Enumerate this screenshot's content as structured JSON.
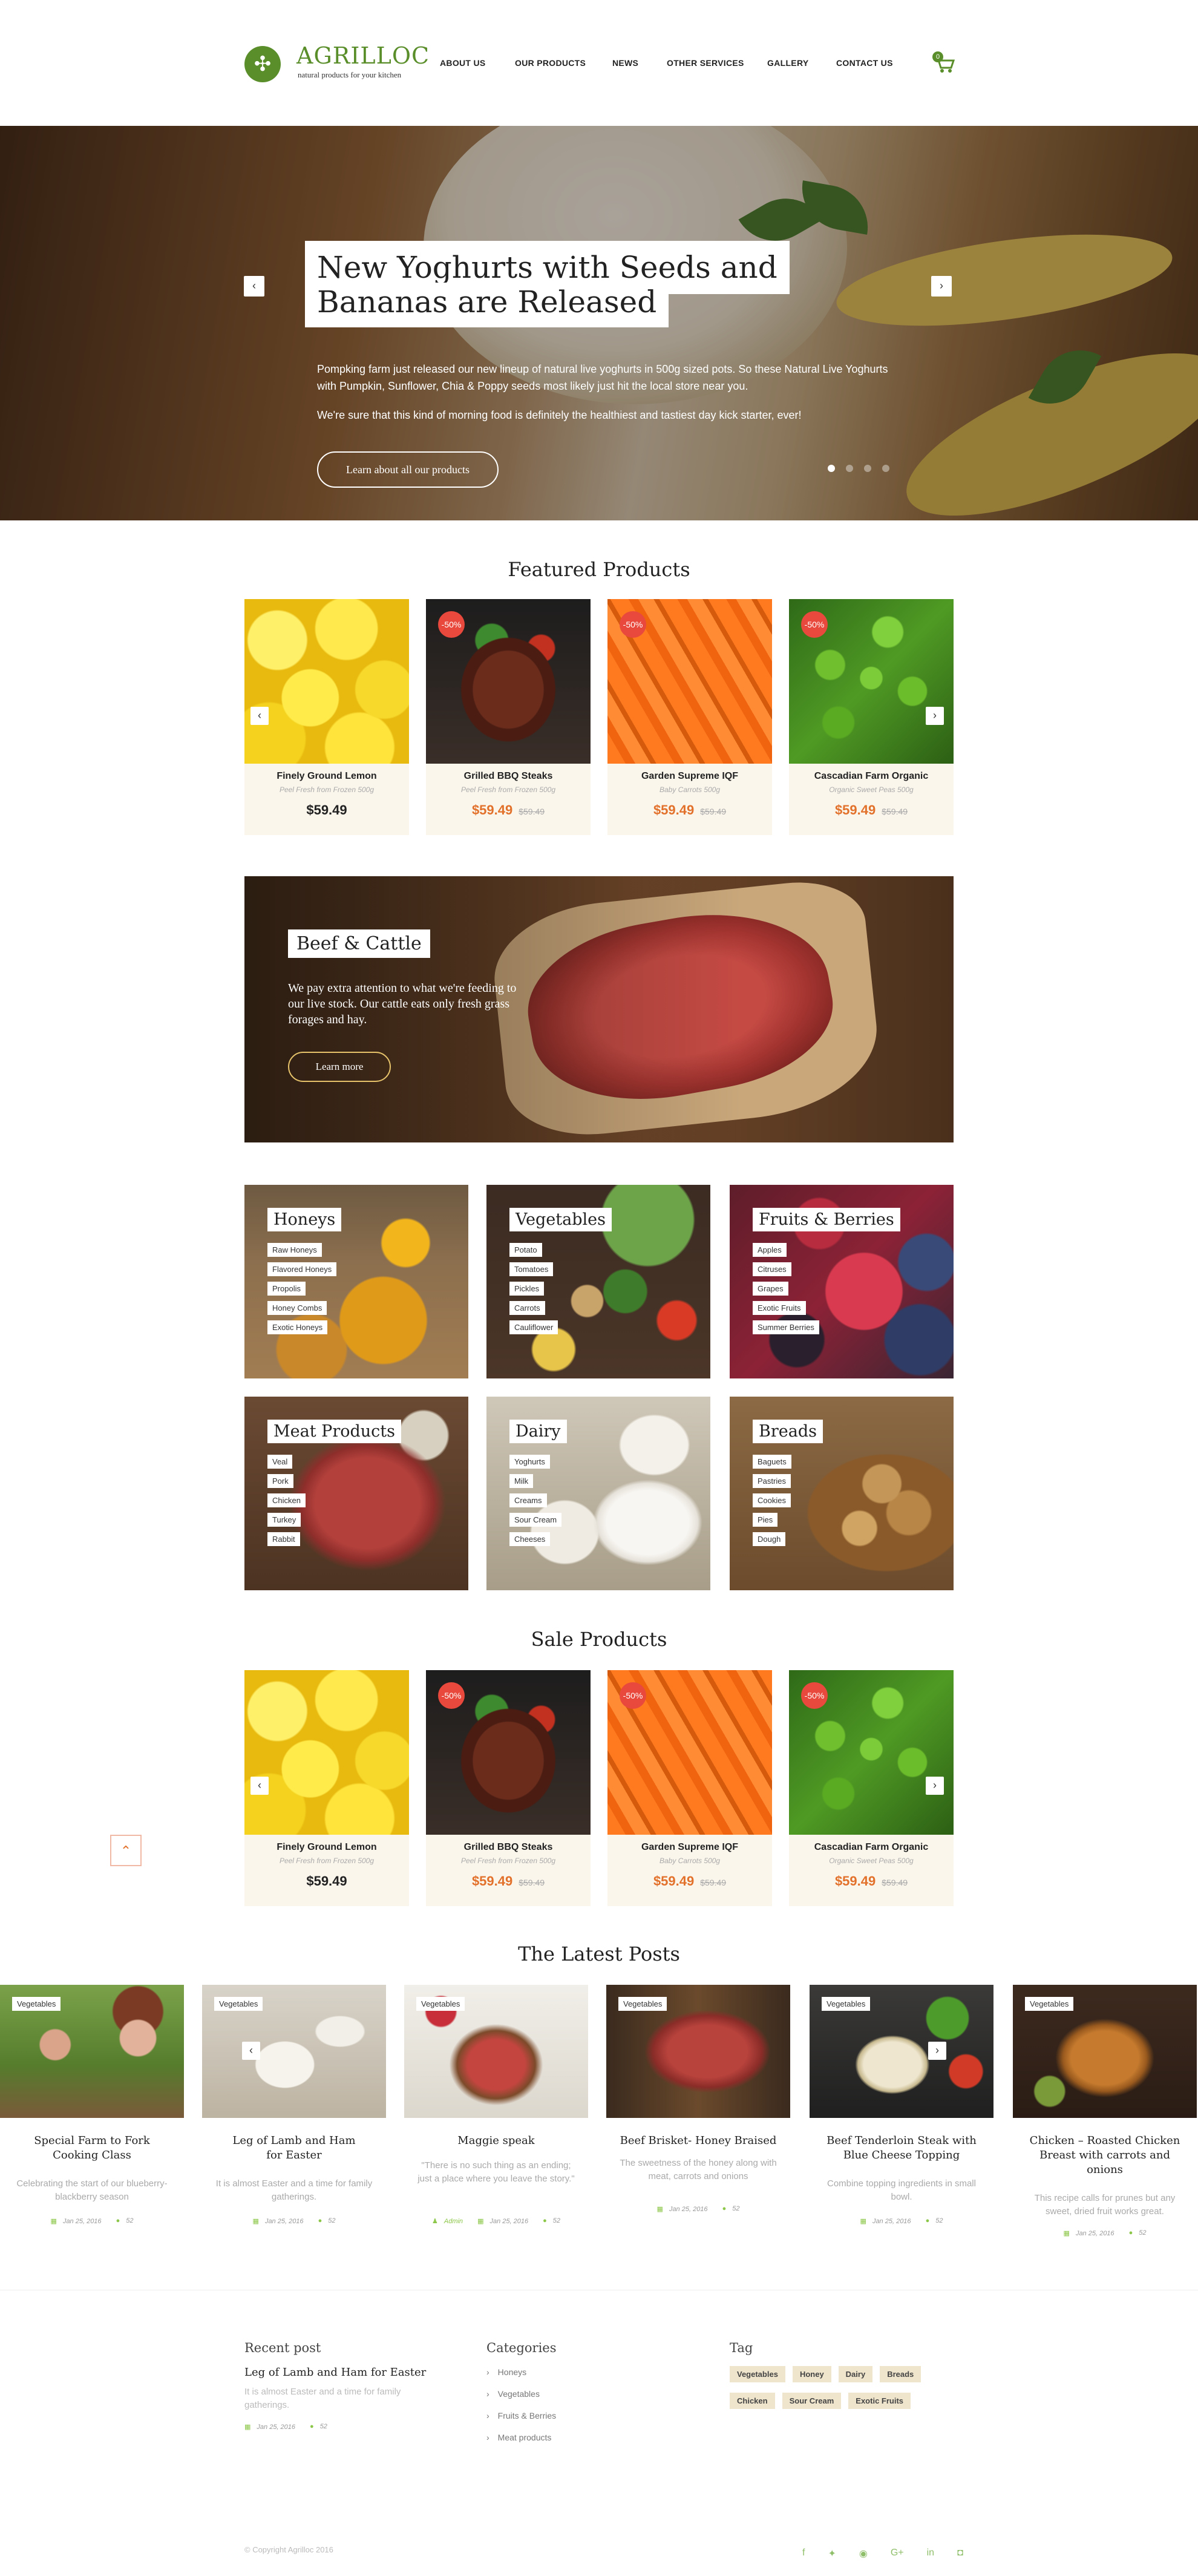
{
  "brand": {
    "name": "AGRILLOC",
    "tagline": "natural products for your kitchen"
  },
  "nav": [
    "ABOUT US",
    "OUR PRODUCTS",
    "NEWS",
    "OTHER SERVICES",
    "GALLERY",
    "CONTACT US"
  ],
  "cart": {
    "count": "0",
    "icon": "cart-icon"
  },
  "hero": {
    "title_line1": "New Yoghurts with Seeds and",
    "title_line2": "Bananas are Released",
    "text1": "Pompking farm just released our new lineup of natural live yoghurts in 500g sized pots. So these Natural Live Yoghurts with Pumpkin, Sunflower, Chia & Poppy seeds most likely just hit the local store near you.",
    "text2": "We're sure that this kind of morning food is definitely the healthiest and tastiest day kick starter, ever!",
    "button": "Learn about all our products"
  },
  "featured": {
    "title": "Featured Products",
    "products": [
      {
        "name": "Finely Ground Lemon",
        "sub": "Peel Fresh from Frozen 500g",
        "price": "$59.49",
        "old": "",
        "badge": ""
      },
      {
        "name": "Grilled BBQ Steaks",
        "sub": "Peel Fresh from Frozen 500g",
        "price": "$59.49",
        "old": "$59.49",
        "badge": "-50%"
      },
      {
        "name": "Garden Supreme IQF",
        "sub": "Baby Carrots 500g",
        "price": "$59.49",
        "old": "$59.49",
        "badge": "-50%"
      },
      {
        "name": "Cascadian Farm Organic",
        "sub": "Organic Sweet Peas 500g",
        "price": "$59.49",
        "old": "$59.49",
        "badge": "-50%"
      }
    ]
  },
  "beef": {
    "title": "Beef & Cattle",
    "text": "We pay extra attention to what we're feeding to our live stock. Our cattle eats only fresh grass forages and hay.",
    "button": "Learn more"
  },
  "categories": [
    {
      "title": "Honeys",
      "items": [
        "Raw Honeys",
        "Flavored Honeys",
        "Propolis",
        "Honey Combs",
        "Exotic Honeys"
      ]
    },
    {
      "title": "Vegetables",
      "items": [
        "Potato",
        "Tomatoes",
        "Pickles",
        "Carrots",
        "Cauliflower"
      ]
    },
    {
      "title": "Fruits & Berries",
      "items": [
        "Apples",
        "Citruses",
        "Grapes",
        "Exotic Fruits",
        "Summer Berries"
      ]
    },
    {
      "title": "Meat Products",
      "items": [
        "Veal",
        "Pork",
        "Chicken",
        "Turkey",
        "Rabbit"
      ]
    },
    {
      "title": "Dairy",
      "items": [
        "Yoghurts",
        "Milk",
        "Creams",
        "Sour Cream",
        "Cheeses"
      ]
    },
    {
      "title": "Breads",
      "items": [
        "Baguets",
        "Pastries",
        "Cookies",
        "Pies",
        "Dough"
      ]
    }
  ],
  "sale": {
    "title": "Sale Products",
    "products": [
      {
        "name": "Finely Ground Lemon",
        "sub": "Peel Fresh from Frozen 500g",
        "price": "$59.49",
        "old": "",
        "badge": ""
      },
      {
        "name": "Grilled BBQ Steaks",
        "sub": "Peel Fresh from Frozen 500g",
        "price": "$59.49",
        "old": "$59.49",
        "badge": "-50%"
      },
      {
        "name": "Garden Supreme IQF",
        "sub": "Baby Carrots 500g",
        "price": "$59.49",
        "old": "$59.49",
        "badge": "-50%"
      },
      {
        "name": "Cascadian Farm Organic",
        "sub": "Organic Sweet Peas 500g",
        "price": "$59.49",
        "old": "$59.49",
        "badge": "-50%"
      }
    ]
  },
  "posts": {
    "title": "The Latest Posts",
    "items": [
      {
        "tag": "Vegetables",
        "title_l1": "Special Farm to Fork",
        "title_l2": "Cooking Class",
        "text": "Celebrating the start of our blueberry-blackberry season",
        "date": "Jan 25, 2016",
        "comments": "52",
        "author": ""
      },
      {
        "tag": "Vegetables",
        "title_l1": "Leg of Lamb and Ham",
        "title_l2": "for Easter",
        "text": "It is almost Easter and a time for family gatherings.",
        "date": "Jan 25, 2016",
        "comments": "52",
        "author": ""
      },
      {
        "tag": "Vegetables",
        "title_l1": "Maggie speak",
        "title_l2": "",
        "text": "\"There is no such thing as an ending; just a place where you leave the story.\"",
        "date": "Jan 25, 2016",
        "comments": "52",
        "author": "Admin"
      },
      {
        "tag": "Vegetables",
        "title_l1": "Beef Brisket- Honey Braised",
        "title_l2": "",
        "text": "The sweetness of the honey along with meat, carrots and onions",
        "date": "Jan 25, 2016",
        "comments": "52",
        "author": ""
      },
      {
        "tag": "Vegetables",
        "title_l1": "Beef Tenderloin Steak with",
        "title_l2": "Blue Cheese Topping",
        "text": "Combine topping ingredients in small bowl.",
        "date": "Jan 25, 2016",
        "comments": "52",
        "author": ""
      },
      {
        "tag": "Vegetables",
        "title_l1": "Chicken – Roasted Chicken",
        "title_l2": "Breast with carrots and onions",
        "text": "This recipe calls for prunes but any sweet, dried fruit works great.",
        "date": "Jan 25, 2016",
        "comments": "52",
        "author": ""
      }
    ]
  },
  "footer": {
    "recent_title": "Recent post",
    "recent_post_title": "Leg of Lamb and Ham for Easter",
    "recent_post_text": "It is almost Easter and a time for family gatherings.",
    "recent_date": "Jan 25, 2016",
    "recent_comments": "52",
    "categories_title": "Categories",
    "categories": [
      "Honeys",
      "Vegetables",
      "Fruits & Berries",
      "Meat products"
    ],
    "tag_title": "Tag",
    "tags_row1": [
      "Vegetables",
      "Honey",
      "Dairy",
      "Breads"
    ],
    "tags_row2": [
      "Chicken",
      "Sour Cream",
      "Exotic Fruits"
    ],
    "copyright": "© Copyright Agrilloc 2016",
    "social": [
      "facebook-icon",
      "twitter-icon",
      "rss-icon",
      "google-plus-icon",
      "linkedin-icon",
      "instagram-icon"
    ]
  },
  "colors": {
    "brand_green": "#5a8e2a",
    "price_orange": "#e2712b",
    "badge_red": "#e8493c",
    "card_bg": "#fbf6ec",
    "tag_bg": "#efe4cc"
  }
}
